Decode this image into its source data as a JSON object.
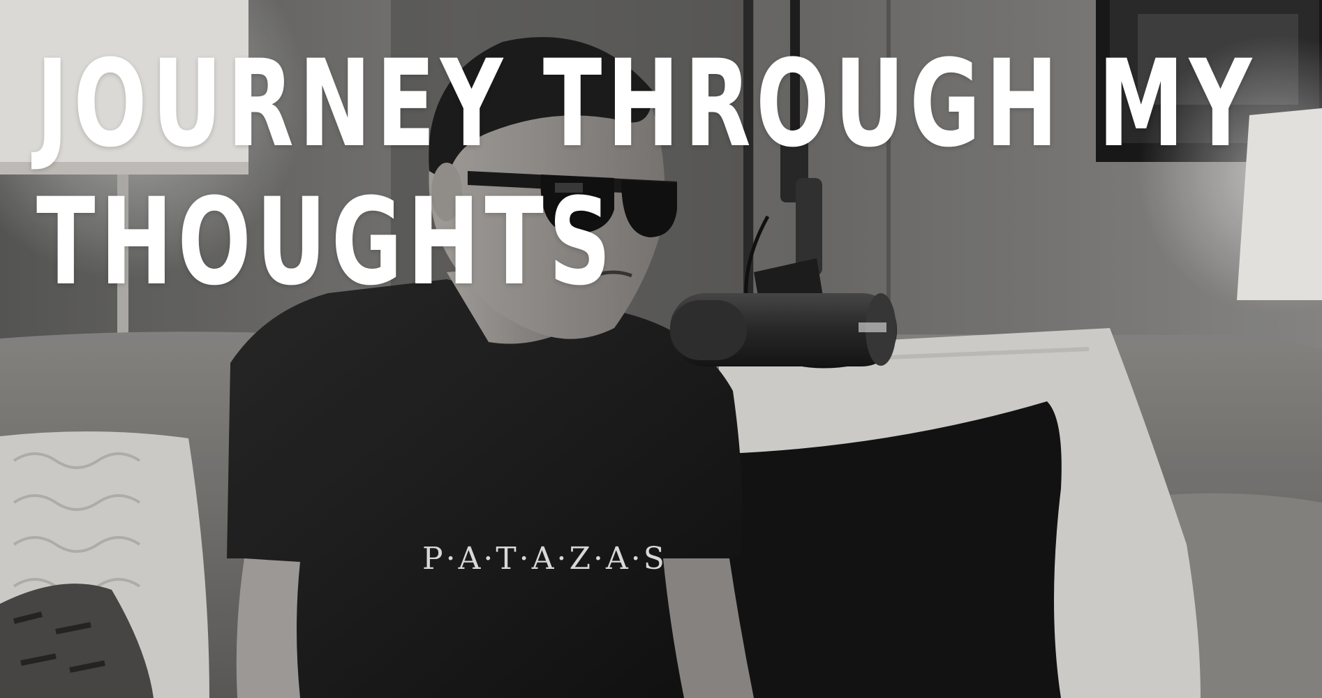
{
  "headline": {
    "line1": "JOURNEY THROUGH MY",
    "line2": "THOUGHTS"
  },
  "photo": {
    "shirt_text": "P·A·T·A·Z·A·S",
    "tone": "black-and-white"
  },
  "colors": {
    "headline_text": "#ffffff",
    "wall": "#6f6e6c",
    "sofa": "#7d7b79",
    "shirt": "#1b1b1b",
    "pillow_dark": "#141414",
    "pillow_light": "#d8d6d2"
  },
  "icons": {
    "microphone": "microphone-icon",
    "lamp": "lamp-icon"
  }
}
